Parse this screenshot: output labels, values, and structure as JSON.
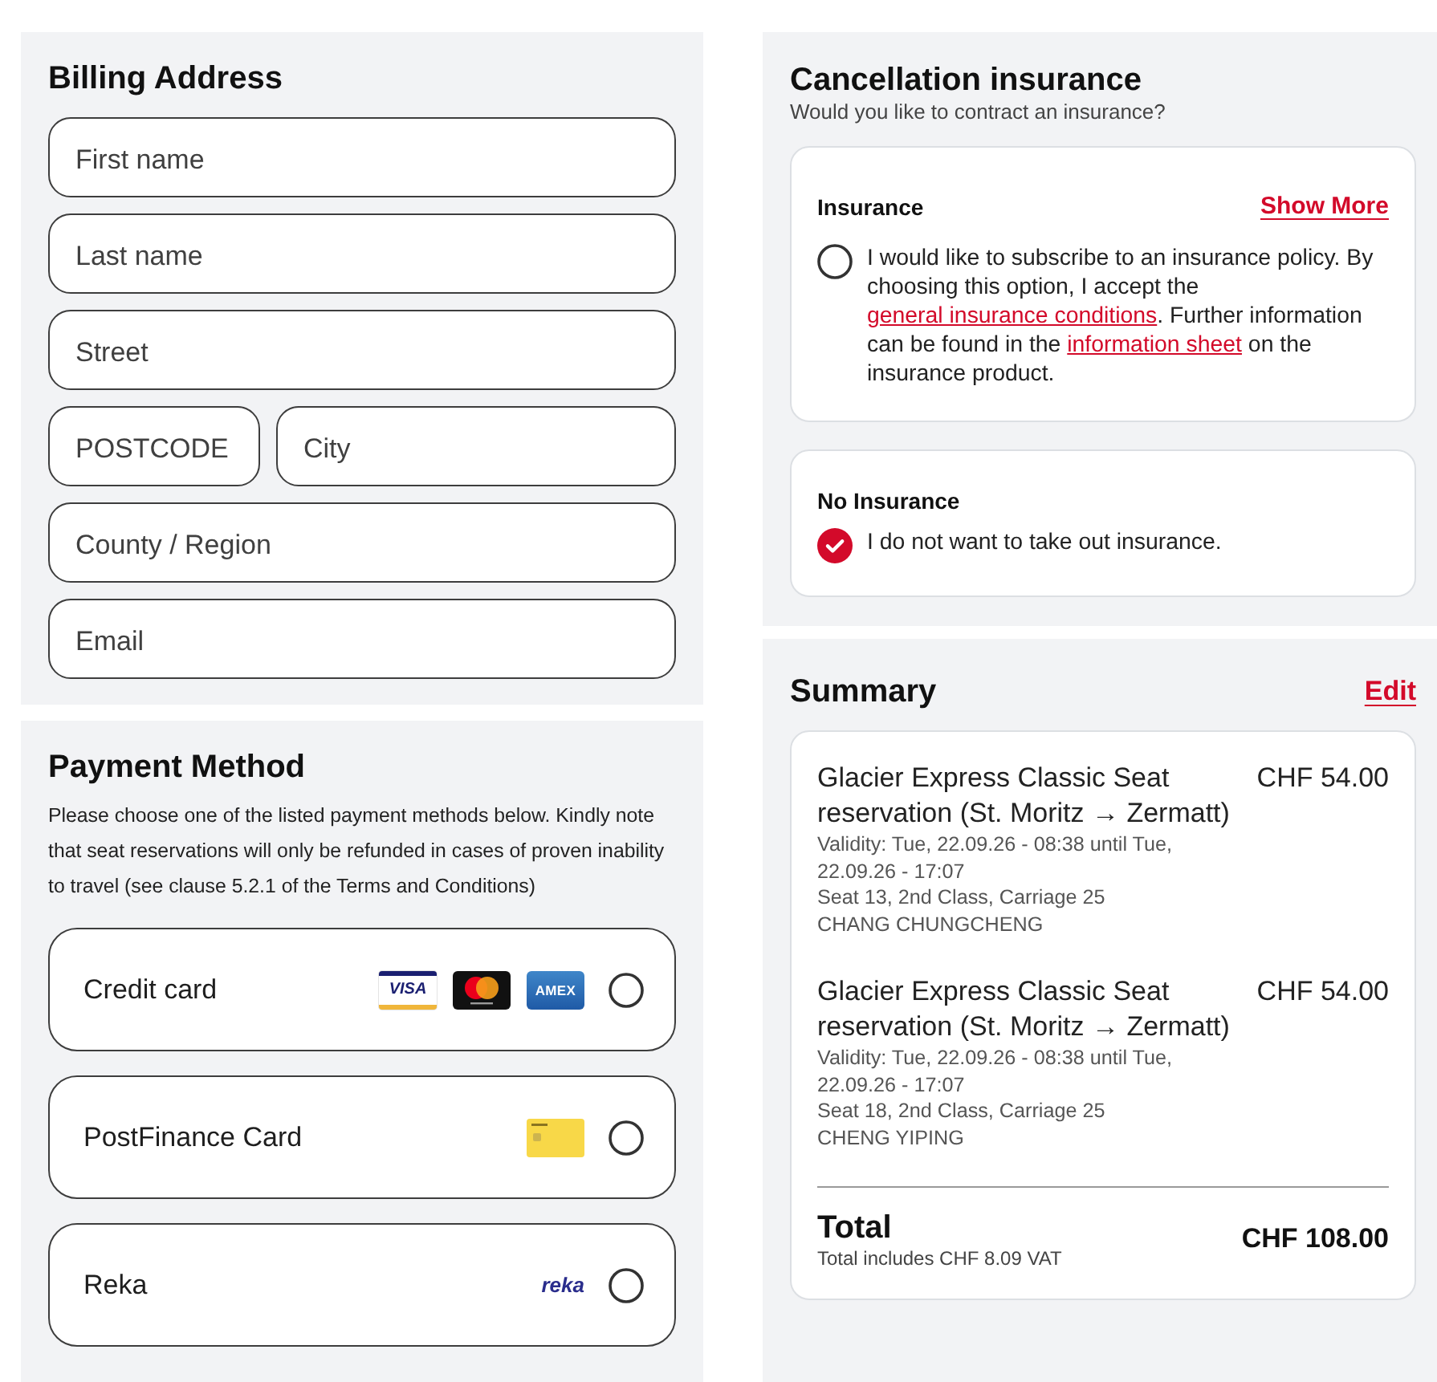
{
  "billing_address": {
    "title": "Billing Address",
    "rows": [
      [
        {
          "placeholder": "First name"
        }
      ],
      [
        {
          "placeholder": "Last name"
        }
      ],
      [
        {
          "placeholder": "Street"
        }
      ],
      [
        {
          "placeholder": "POSTCODE"
        },
        {
          "placeholder": "City"
        }
      ],
      [
        {
          "placeholder": "County / Region"
        }
      ],
      [
        {
          "placeholder": "Email"
        }
      ]
    ]
  },
  "payment": {
    "title": "Payment Method",
    "description": "Please choose one of the listed payment methods below. Kindly note that seat reservations will only be refunded in cases of proven inability to travel (see clause 5.2.1 of the Terms and Conditions)",
    "methods": [
      {
        "label": "Credit card",
        "logos": [
          {
            "kind": "visa",
            "text": "VISA"
          },
          {
            "kind": "mastercard"
          },
          {
            "kind": "amex",
            "text": "AMEX"
          }
        ],
        "selected": false
      },
      {
        "label": "PostFinance Card",
        "logos": [
          {
            "kind": "card"
          }
        ],
        "selected": false
      },
      {
        "label": "Reka",
        "logos": [
          {
            "kind": "reka",
            "text": "reka"
          }
        ],
        "selected": false
      }
    ]
  },
  "insurance": {
    "title": "Cancellation insurance",
    "subtitle": "Would you like to contract an insurance?",
    "options": [
      {
        "title": "Insurance",
        "link": "Show More",
        "parts": [
          {
            "text": "I would like to subscribe to an insurance policy. By choosing this option, I accept the "
          },
          {
            "kind": "link",
            "text": "general insurance conditions"
          },
          {
            "text": ". Further information can be found in the "
          },
          {
            "kind": "link",
            "text": "information sheet"
          },
          {
            "text": " on the insurance product."
          }
        ],
        "selected": false
      },
      {
        "title": "No Insurance",
        "parts": [
          {
            "text": "I do not want to take out insurance."
          }
        ],
        "selected": true
      }
    ]
  },
  "summary": {
    "title": "Summary",
    "edit": "Edit",
    "items": [
      {
        "title": "Glacier Express Classic Seat reservation (St. Moritz → Zermatt)",
        "price": "CHF 54.00",
        "details": [
          "Validity: Tue, 22.09.26 - 08:38 until Tue, 22.09.26 - 17:07",
          "Seat 13, 2nd Class, Carriage 25",
          "CHANG CHUNGCHENG"
        ]
      },
      {
        "title": "Glacier Express Classic Seat reservation (St. Moritz → Zermatt)",
        "price": "CHF 54.00",
        "details": [
          "Validity: Tue, 22.09.26 - 08:38 until Tue, 22.09.26 - 17:07",
          "Seat 18, 2nd Class, Carriage 25",
          "CHENG YIPING"
        ]
      }
    ],
    "total": {
      "label": "Total",
      "note": "Total includes CHF 8.09 VAT",
      "amount": "CHF 108.00"
    }
  }
}
